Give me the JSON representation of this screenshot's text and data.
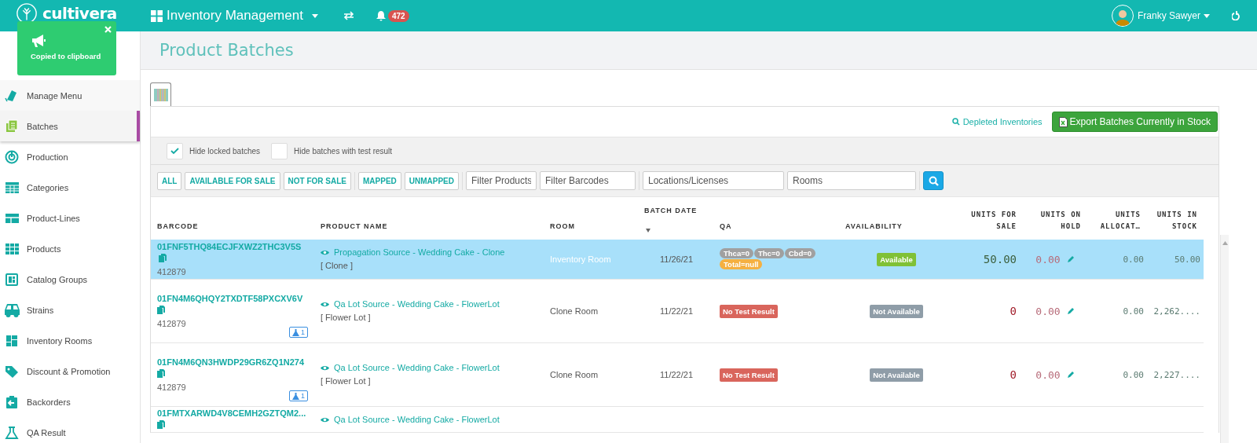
{
  "header": {
    "logo": "cultivera",
    "module": "Inventory Management",
    "notifications": "472",
    "user": "Franky Sawyer"
  },
  "toast": {
    "message": "Copied to clipboard"
  },
  "sidebar": {
    "items": [
      {
        "label": "Manage Menu",
        "selected": false
      },
      {
        "label": "Batches",
        "selected": true
      },
      {
        "label": "Production",
        "selected": false
      },
      {
        "label": "Categories",
        "selected": false
      },
      {
        "label": "Product-Lines",
        "selected": false
      },
      {
        "label": "Products",
        "selected": false
      },
      {
        "label": "Catalog Groups",
        "selected": false
      },
      {
        "label": "Strains",
        "selected": false
      },
      {
        "label": "Inventory Rooms",
        "selected": false
      },
      {
        "label": "Discount & Promotion",
        "selected": false
      },
      {
        "label": "Backorders",
        "selected": false
      },
      {
        "label": "QA Result",
        "selected": false
      }
    ]
  },
  "page_title": "Product Batches",
  "actions": {
    "link": "Depleted Inventories",
    "export": "Export Batches Currently in Stock"
  },
  "options": [
    {
      "label": "Hide locked batches",
      "checked": true
    },
    {
      "label": "Hide batches with test result",
      "checked": false
    }
  ],
  "filter_groups": [
    [
      "ALL",
      "AVAILABLE FOR SALE",
      "NOT FOR SALE"
    ],
    [
      "MAPPED",
      "UNMAPPED"
    ]
  ],
  "filter_fields": [
    {
      "placeholder": "Filter Products"
    },
    {
      "placeholder": "Filter Barcodes"
    },
    {
      "placeholder": "Locations/Licenses"
    },
    {
      "placeholder": "Rooms"
    }
  ],
  "table": {
    "columns": [
      "BARCODE",
      "PRODUCT NAME",
      "ROOM",
      "BATCH DATE",
      "QA",
      "AVAILABILITY",
      "UNITS FOR SALE",
      "UNITS ON HOLD",
      "UNITS ALLOCAT…",
      "UNITS IN STOCK"
    ],
    "rows": [
      {
        "selected": true,
        "barcode": "01FNF5THQ84ECJFXWZ2THC3V5S",
        "lot": "412879",
        "tests": "",
        "product": "Propagation Source - Wedding Cake - Clone",
        "type": "[ Clone ]",
        "room": "Inventory Room",
        "date": "11/26/21",
        "qa": [
          {
            "text": "Thca=0",
            "kind": "neutral"
          },
          {
            "text": "Thc=0",
            "kind": "neutral"
          },
          {
            "text": "Cbd=0",
            "kind": "neutral"
          },
          {
            "text": "Total=null",
            "kind": "warning"
          }
        ],
        "availability": {
          "text": "Available",
          "kind": "available"
        },
        "for_sale": "50.00",
        "on_hold": "0.00",
        "allocated": "0.00",
        "in_stock": "50.00"
      },
      {
        "selected": false,
        "barcode": "01FN4M6QHQY2TXDTF58PXCXV6V",
        "lot": "412879",
        "tests": "1",
        "product": "Qa Lot Source - Wedding Cake - FlowerLot",
        "type": "[ Flower Lot ]",
        "room": "Clone Room",
        "date": "11/22/21",
        "qa": [
          {
            "text": "No Test Result",
            "kind": "missing"
          }
        ],
        "availability": {
          "text": "Not Available",
          "kind": "unavailable"
        },
        "for_sale": "0",
        "on_hold": "0.00",
        "allocated": "0.00",
        "in_stock": "2,262...."
      },
      {
        "selected": false,
        "barcode": "01FN4M6QN3HWDP29GR6ZQ1N274",
        "lot": "412879",
        "tests": "1",
        "product": "Qa Lot Source - Wedding Cake - FlowerLot",
        "type": "[ Flower Lot ]",
        "room": "Clone Room",
        "date": "11/22/21",
        "qa": [
          {
            "text": "No Test Result",
            "kind": "missing"
          }
        ],
        "availability": {
          "text": "Not Available",
          "kind": "unavailable"
        },
        "for_sale": "0",
        "on_hold": "0.00",
        "allocated": "0.00",
        "in_stock": "2,227...."
      },
      {
        "selected": false,
        "barcode": "01FMTXARWD4V8CEMH2GZTQM2...",
        "product": "Qa Lot Source - Wedding Cake - FlowerLot"
      }
    ]
  }
}
